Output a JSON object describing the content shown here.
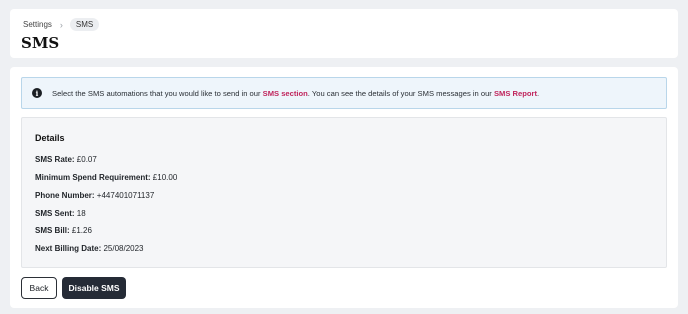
{
  "breadcrumb": {
    "items": [
      "Settings",
      "SMS"
    ],
    "separator": "›"
  },
  "page": {
    "title": "SMS"
  },
  "info": {
    "text_before": "Select the SMS automations that you would like to send in our ",
    "link1": "SMS section",
    "text_middle": ". You can see the details of your SMS messages in our ",
    "link2": "SMS Report",
    "text_after": ".",
    "icon": "info-icon"
  },
  "details": {
    "heading": "Details",
    "rows": [
      {
        "label": "SMS Rate:",
        "value": "£0.07"
      },
      {
        "label": "Minimum Spend Requirement:",
        "value": "£10.00"
      },
      {
        "label": "Phone Number:",
        "value": "+447401071137"
      },
      {
        "label": "SMS Sent:",
        "value": "18"
      },
      {
        "label": "SMS Bill:",
        "value": "£1.26"
      },
      {
        "label": "Next Billing Date:",
        "value": "25/08/2023"
      }
    ]
  },
  "actions": {
    "back_label": "Back",
    "disable_label": "Disable SMS"
  },
  "colors": {
    "accent_link": "#c0255c",
    "primary_button": "#252b36",
    "info_background": "#eef5fb"
  }
}
